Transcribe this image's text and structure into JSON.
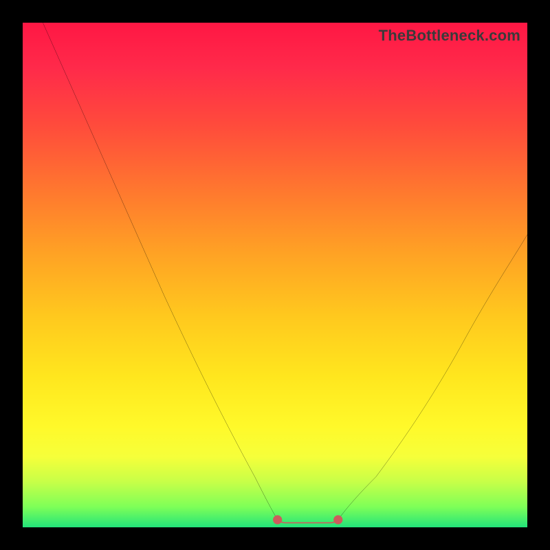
{
  "watermark": "TheBottleneck.com",
  "chart_data": {
    "type": "line",
    "title": "",
    "xlabel": "",
    "ylabel": "",
    "xlim": [
      0,
      100
    ],
    "ylim": [
      0,
      100
    ],
    "series": [
      {
        "name": "curve-left",
        "x": [
          4,
          8,
          12,
          16,
          20,
          24,
          28,
          32,
          36,
          40,
          44,
          48,
          50.5
        ],
        "values": [
          100,
          91,
          82,
          73,
          64,
          55,
          46,
          37,
          29,
          21,
          13,
          6,
          1.5
        ]
      },
      {
        "name": "curve-right",
        "x": [
          62.5,
          66,
          70,
          74,
          78,
          82,
          86,
          90,
          94,
          98,
          100
        ],
        "values": [
          1.5,
          5,
          10,
          16,
          22,
          29,
          36,
          43,
          50,
          55,
          58
        ]
      },
      {
        "name": "flat-bottom-highlight",
        "x": [
          50.5,
          53,
          56,
          59,
          62.5
        ],
        "values": [
          1.5,
          1.0,
          1.0,
          1.0,
          1.5
        ]
      }
    ],
    "annotations": [],
    "legend": false,
    "grid": false,
    "colors": {
      "curve": "#000000",
      "highlight": "#cd5c5c",
      "gradient_top": "#ff1744",
      "gradient_mid": "#ffe61e",
      "gradient_bottom": "#22e37a",
      "frame": "#000000"
    }
  }
}
